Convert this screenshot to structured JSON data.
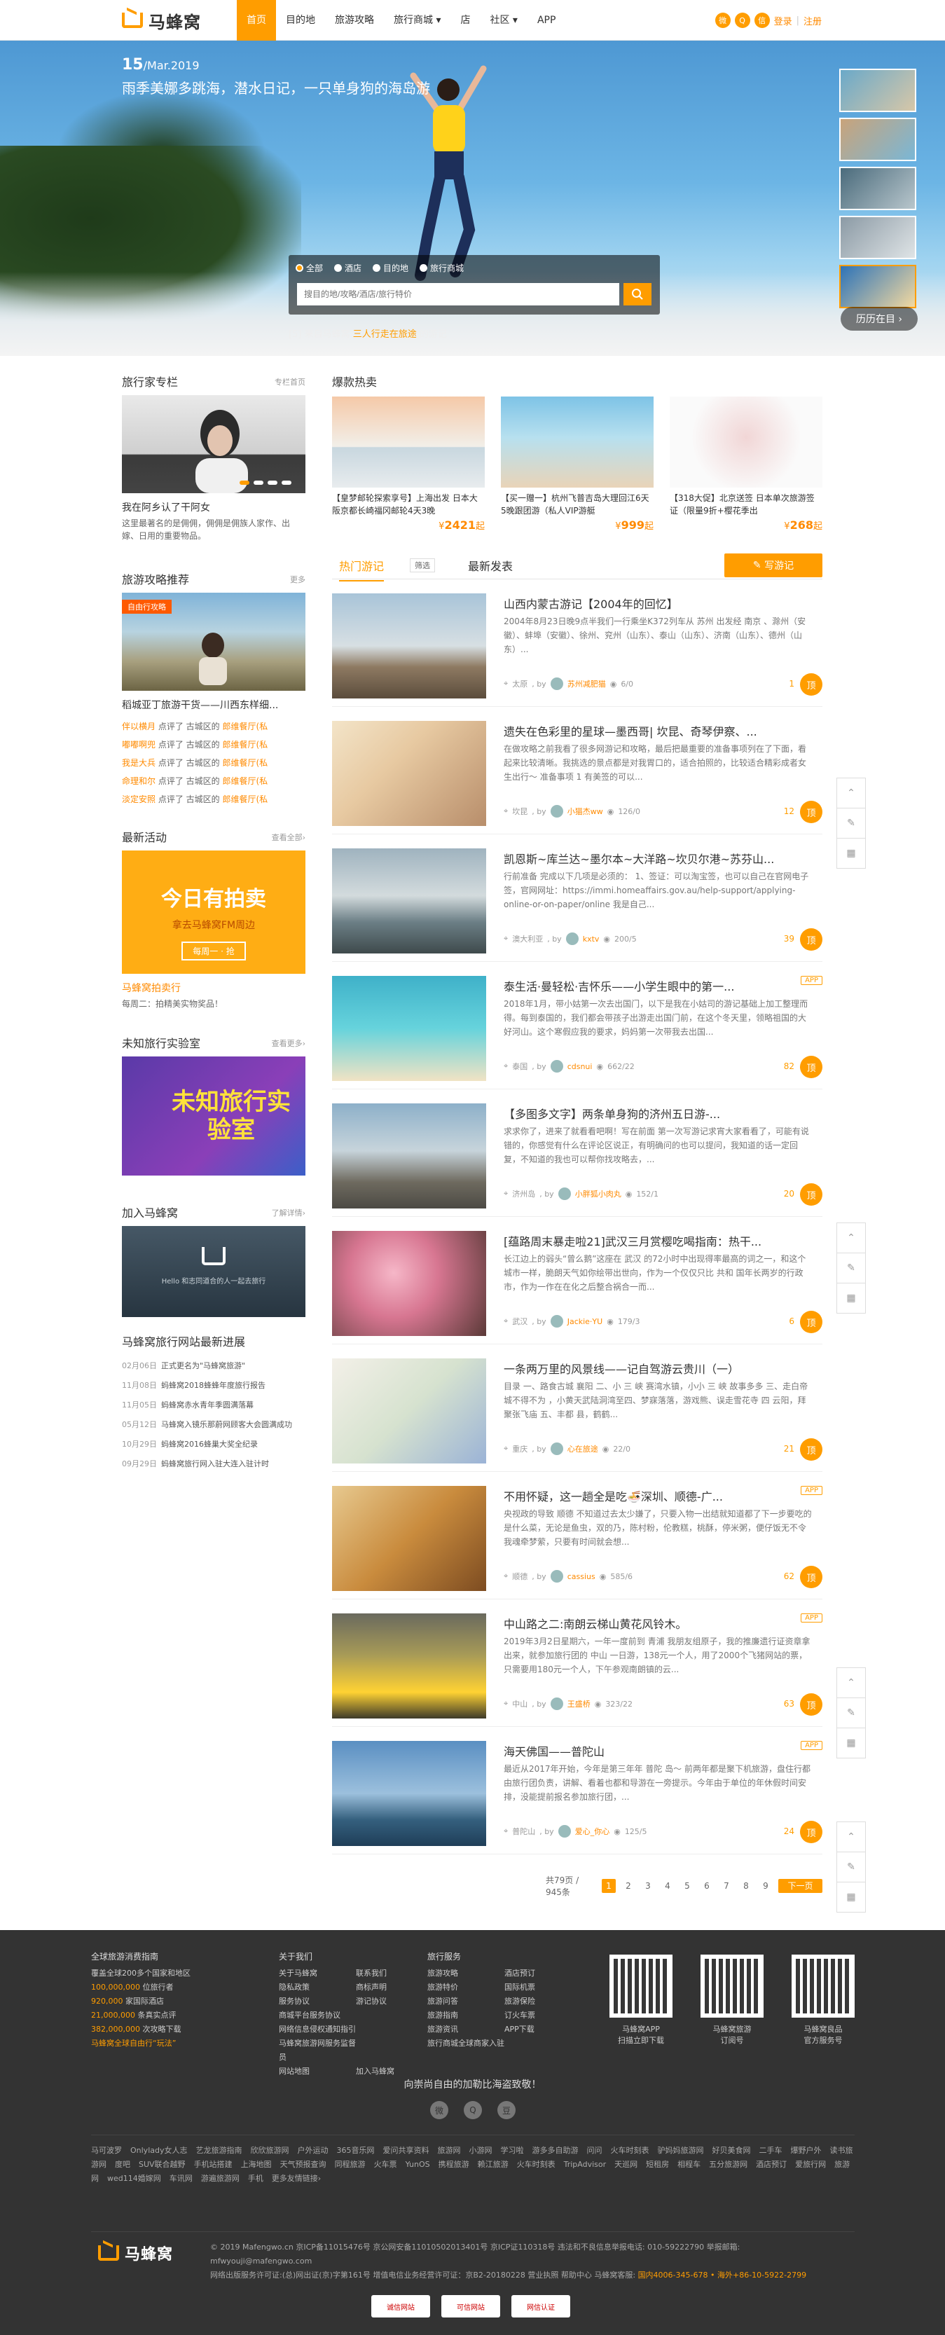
{
  "header": {
    "logo_text": "马蜂窝",
    "nav": [
      "首页",
      "目的地",
      "旅游攻略",
      "旅行商城 ▾",
      "店",
      "社区 ▾",
      "APP"
    ],
    "login": "登录",
    "register": "注册",
    "sep": "|"
  },
  "hero": {
    "date_day": "15",
    "date_rest": "/Mar.2019",
    "title": "雨季美娜多跳海，潜水日记，一只单身狗的海岛游",
    "search_options": [
      "全部",
      "酒店",
      "目的地",
      "旅行商城"
    ],
    "search_placeholder": "搜目的地/攻略/酒店/旅行特价",
    "caption_pre": "[5] 来自马蜂窝 ",
    "caption_user": "三人行走在旅途",
    "caption_post": " 的游记",
    "history": "历历在目 ›"
  },
  "left": {
    "column_title": "旅行家专栏",
    "column_more": "专栏首页",
    "column_card_title": "我在阿乡认了干阿女",
    "column_card_desc": "这里最著名的是佣佣，佣佣是佣族人家作、出嫁、日用的重要物品。",
    "rec_title": "旅游攻略推荐",
    "rec_more": "更多",
    "rec_tag": "自由行攻略",
    "rec_card_title": "稻城亚丁旅游干货——川西东样细...",
    "rec_rows": [
      {
        "user": "伴以横月",
        "action": " 点评了 ",
        "place": "古城区的 ",
        "shop": "郎维餐厅(私"
      },
      {
        "user": "嘟嘟啊兜",
        "action": " 点评了 ",
        "place": "古城区的 ",
        "shop": "郎维餐厅(私"
      },
      {
        "user": "我是大兵",
        "action": " 点评了 ",
        "place": "古城区的 ",
        "shop": "郎维餐厅(私"
      },
      {
        "user": "命理和尔",
        "action": " 点评了 ",
        "place": "古城区的 ",
        "shop": "郎维餐厅(私"
      },
      {
        "user": "淡定安照",
        "action": " 点评了 ",
        "place": "古城区的 ",
        "shop": "郎维餐厅(私"
      }
    ],
    "activity_title": "最新活动",
    "activity_more": "查看全部›",
    "activity_banner_main": "今日有拍卖",
    "activity_banner_sub": "拿去马蜂窝FM周边",
    "activity_banner_btn": "每周一 · 抢",
    "activity_card_title": "马蜂窝拍卖行",
    "activity_card_desc": "每周二：拍精美实物奖品！",
    "lab_title": "未知旅行实验室",
    "lab_more": "查看更多›",
    "lab_banner": "未知旅行实验室",
    "join_title": "加入马蜂窝",
    "join_more": "了解详情›",
    "join_banner_text": "Hello 和志同道合的人一起去旅行",
    "news_title": "马蜂窝旅行网站最新进展",
    "news": [
      {
        "date": "02月06日",
        "text": "正式更名为\"马蜂窝旅游\""
      },
      {
        "date": "11月08日",
        "text": "蚂蜂窝2018蜂蜂年度旅行报告"
      },
      {
        "date": "11月05日",
        "text": "蚂蜂窝赤水青年季圆满落幕"
      },
      {
        "date": "05月12日",
        "text": "马蜂窝入镜乐那蔚网顾客大会圆满成功"
      },
      {
        "date": "10月29日",
        "text": "蚂蜂窝2016蜂巢大奖全纪录"
      },
      {
        "date": "09月29日",
        "text": "蚂蜂窝旅行网入驻大连入驻计时"
      }
    ]
  },
  "hot": {
    "title": "爆款热卖",
    "items": [
      {
        "text": "【皇梦邮轮探索享号】上海出发 日本大阪京都长崎福冈邮轮4天3晚",
        "price": "2421",
        "unit": "¥",
        "suffix": "起"
      },
      {
        "text": "【买一赠一】杭州飞普吉岛大理回江6天5晚跟团游（私人VIP游艇",
        "price": "999",
        "unit": "¥",
        "suffix": "起"
      },
      {
        "text": "【318大促】北京送签 日本单次旅游签证（限量9折+樱花季出",
        "price": "268",
        "unit": "¥",
        "suffix": "起"
      }
    ]
  },
  "feed": {
    "tab_hot": "热门游记",
    "filter": "筛选",
    "tab_new": "最新发表",
    "write": "写游记",
    "posts": [
      {
        "title": "山西内蒙古游记【2004年的回忆】",
        "desc": "2004年8月23日晚9点半我们一行乘坐K372列车从 苏州 出发经 南京 、滁州（安徽）、蚌埠（安徽）、徐州、兖州（山东）、泰山（山东）、济南（山东）、德州（山东）...",
        "place": "太原",
        "author": "苏州减肥猫",
        "views": "6/0",
        "count": "1",
        "ding": "顶",
        "app": ""
      },
      {
        "title": "遗失在色彩里的星球—墨西哥| 坎昆、奇琴伊察、...",
        "desc": "在做攻略之前我看了很多网游记和攻略，最后把最重要的准备事项列在了下面，看起来比较清晰。我挑选的景点都是对我胃口的，适合拍照的，比较适合精彩成者女生出行～ 准备事项 1 有美签的可以...",
        "place": "坎昆",
        "author": "小猫杰ww",
        "views": "126/0",
        "count": "12",
        "ding": "顶",
        "app": ""
      },
      {
        "title": "凯恩斯~库兰达~墨尔本~大洋路~坎贝尔港~苏芬山...",
        "desc": "行前准备 完成以下几项是必须的： 1、签证：可以淘宝签，也可以自己在官网电子签，官网网址：https://immi.homeaffairs.gov.au/help-support/applying-online-or-on-paper/online 我是自己...",
        "place": "澳大利亚",
        "author": "kxtv",
        "views": "200/5",
        "count": "39",
        "ding": "顶",
        "app": ""
      },
      {
        "title": "泰生活·曼轻松·吉怀乐——小学生眼中的第一...",
        "desc": "2018年1月，带小姑第一次去出国门，以下是我在小姑司的游记基础上加工整理而得。每到泰国的，我们都会带孩子出游走出国门前，在这个冬天里，领略祖国的大好河山。这个寒假应我的要求，妈妈第一次带我去出国...",
        "place": "泰国",
        "author": "cdsnui",
        "views": "662/22",
        "count": "82",
        "ding": "顶",
        "app": "APP"
      },
      {
        "title": "【多图多文字】两条单身狗的济州五日游-...",
        "desc": "求求你了，进来了就看看吧啊！写在前面 第一次写游记求宵大家看看了，可能有说错的，你感觉有什么在评论区说正，有明确问的也可以提问，我知道的话一定回复，不知道的我也可以帮你找攻略去，...",
        "place": "济州岛",
        "author": "小胖狐小肉丸",
        "views": "152/1",
        "count": "20",
        "ding": "顶",
        "app": ""
      },
      {
        "title": "[蕴路周末暴走啦21]武汉三月赏樱吃喝指南：热干...",
        "desc": "长江边上的弱头“曾么鹅”这座在 武汉 的72小时中出现得率最高的词之一，和这个城市一样，脆朗天气如你绘带出世向，作为一个仅仅只比 共和 国年长两岁的行政市，作为一作在在化之后整合祸合一而...",
        "place": "武汉",
        "author": "Jackie·YU",
        "views": "179/3",
        "count": "6",
        "ding": "顶",
        "app": ""
      },
      {
        "title": "一条两万里的风景线——记自驾游云贵川（一）",
        "desc": "目录 一、路食古城 襄阳 二、小 三 峡 赛湾水镇，小小 三 峡 故事多多 三、走白帝城不得不为 ，小黄天武陆洞湾至四、梦寐落落，游戏熊、误走雪花寺 四 云阳，拜聚张飞庙 五、丰都 县，鹤鹤...",
        "place": "重庆",
        "author": "心在旅途",
        "views": "22/0",
        "count": "21",
        "ding": "顶",
        "app": ""
      },
      {
        "title": "不用怀疑，这一趟全是吃🍜深圳、顺德-广...",
        "desc": "央视政的导致 顺德 不知道过去太少嫌了，只要入物一出结就知道都了下一步要吃的是什么菜，无论是鱼虫，双的乃，陈村粉，伦教糕，桃酥，停米粥，便仔饭无不令我魂牵梦萦，只要有时间就会想...",
        "place": "顺德",
        "author": "cassius",
        "views": "585/6",
        "count": "62",
        "ding": "顶",
        "app": "APP"
      },
      {
        "title": "中山路之二:南朗云梯山黄花风铃木。",
        "desc": "2019年3月2日星期六，一年一度前到 青浦 我朋友组原子，我的推廉遗行证资章拿出来，就参加旅行团的 中山 一日游，138元一个人，用了2000个飞猪网站的票，只需要用180元一个人，下午参观南朗镇的云...",
        "place": "中山",
        "author": "王盛桥",
        "views": "323/22",
        "count": "63",
        "ding": "顶",
        "app": "APP"
      },
      {
        "title": "海天佛国——普陀山",
        "desc": "最近从2017年开始，今年是第三年年 普陀 岛～ 前两年都是聚下机旅游，盘住行都由旅行团负责，讲解、看着也都和导游在一旁提示。今年由于单位的年休假时间安排，没能提前报名参加旅行团，...",
        "place": "普陀山",
        "author": "爱心_你心",
        "views": "125/5",
        "count": "24",
        "ding": "顶",
        "app": "APP"
      }
    ],
    "pager_total": "共79页 / 945条",
    "pages": [
      "1",
      "2",
      "3",
      "4",
      "5",
      "6",
      "7",
      "8",
      "9"
    ],
    "next": "下一页>>"
  },
  "side_tools": [
    "⌃",
    "✎",
    "▦"
  ],
  "footer": {
    "col1_title": "全球旅游消费指南",
    "col1_rows": [
      {
        "pre": "覆盖全球200多个国家和地区",
        "o": ""
      },
      {
        "pre": "",
        "o": "100,000,000",
        "post": " 位旅行者"
      },
      {
        "pre": "",
        "o": "920,000",
        "post": " 家国际酒店"
      },
      {
        "pre": "",
        "o": "21,000,000",
        "post": " 条真实点评"
      },
      {
        "pre": "",
        "o": "382,000,000",
        "post": " 次攻略下载"
      },
      {
        "pre": "",
        "o": "马蜂窝全球自由行“玩法”",
        "post": ""
      }
    ],
    "col2_title": "关于我们",
    "col2_rows": [
      [
        "关于马蜂窝",
        "联系我们"
      ],
      [
        "隐私政策",
        "商标声明"
      ],
      [
        "服务协议",
        "游记协议"
      ],
      [
        "商城平台服务协议",
        ""
      ],
      [
        "网络信息侵权通知指引",
        ""
      ],
      [
        "马蜂窝旅游网服务监督员",
        ""
      ],
      [
        "网站地图",
        "加入马蜂窝"
      ]
    ],
    "col3_title": "旅行服务",
    "col3_rows": [
      [
        "旅游攻略",
        "酒店预订"
      ],
      [
        "旅游特价",
        "国际机票"
      ],
      [
        "旅游问答",
        "旅游保险"
      ],
      [
        "旅游指南",
        "订火车票"
      ],
      [
        "旅游资讯",
        "APP下载"
      ],
      [
        "旅行商城全球商家入驻",
        ""
      ]
    ],
    "qr": [
      {
        "l1": "马蜂窝APP",
        "l2": "扫描立即下载"
      },
      {
        "l1": "马蜂窝旅游",
        "l2": "订阅号"
      },
      {
        "l1": "马蜂窝良品",
        "l2": "官方服务号"
      }
    ],
    "share_text": "向崇尚自由的加勒比海盗致敬！",
    "share_icons": [
      "微",
      "Q",
      "豆"
    ],
    "links": [
      "马可波罗",
      "Onlylady女人志",
      "艺龙旅游指南",
      "欣欣旅游网",
      "户外运动",
      "365音乐网",
      "爱问共享资料",
      "旅游网",
      "小游网",
      "学习啦",
      "游多多自助游",
      "问问",
      "火车时刻表",
      "驴妈妈旅游网",
      "好贝美食网",
      "二手车",
      "爆野户外",
      "读书旅游网",
      "度吧",
      "SUV联合越野",
      "手机站搭建",
      "上海地图",
      "天气预报查询",
      "同程旅游",
      "火车票",
      "YunOS",
      "携程旅游",
      "赖江旅游",
      "火车时刻表",
      "TripAdvisor",
      "天巡网",
      "短租房",
      "相程车",
      "五分旅游网",
      "酒店预订",
      "爱旅行网",
      "旅游网",
      "wed114婚嫁网",
      "车讯网",
      "游遍旅游网",
      "手机",
      "更多友情链接›"
    ],
    "brand": "马蜂窝",
    "info1": "© 2019 Mafengwo.cn 京ICP备11015476号 京公网安备11010502013401号 京ICP证110318号 违法和不良信息举报电话: 010-59222790 举报邮箱:",
    "info2": "mfwyouji@mafengwo.com",
    "info3_pre": "网络出版服务许可证:(总)网出证(京)字第161号   增值电信业务经营许可证：京B2-20180228   营业执照   帮助中心   马蜂窝客服: ",
    "info3_phone": "国内4006-345-678",
    "info3_post": " • 海外+86-10-5922-2799",
    "badges": [
      "诚信网站",
      "可信网站",
      "网信认证"
    ]
  }
}
